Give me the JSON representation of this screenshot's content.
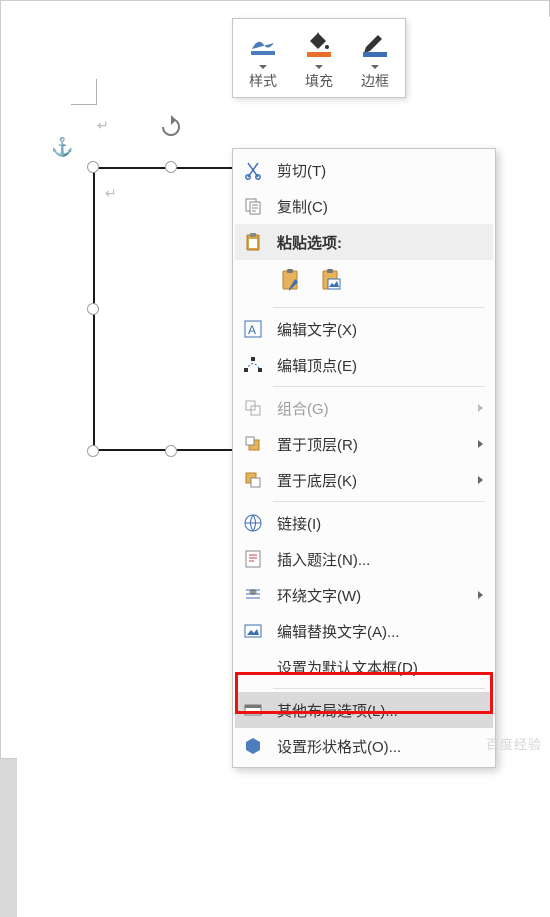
{
  "mini_toolbar": {
    "style": {
      "label": "样式"
    },
    "fill": {
      "label": "填充"
    },
    "outline": {
      "label": "边框"
    }
  },
  "context_menu": {
    "cut": "剪切(T)",
    "copy": "复制(C)",
    "paste_options": "粘贴选项:",
    "edit_text": "编辑文字(X)",
    "edit_points": "编辑顶点(E)",
    "group": "组合(G)",
    "bring_front": "置于顶层(R)",
    "send_back": "置于底层(K)",
    "link": "链接(I)",
    "insert_caption": "插入题注(N)...",
    "wrap_text": "环绕文字(W)",
    "alt_text": "编辑替换文字(A)...",
    "default_textbox": "设置为默认文本框(D)",
    "more_layout": "其他布局选项(L)...",
    "format_shape": "设置形状格式(O)..."
  },
  "watermark": "百度经验"
}
